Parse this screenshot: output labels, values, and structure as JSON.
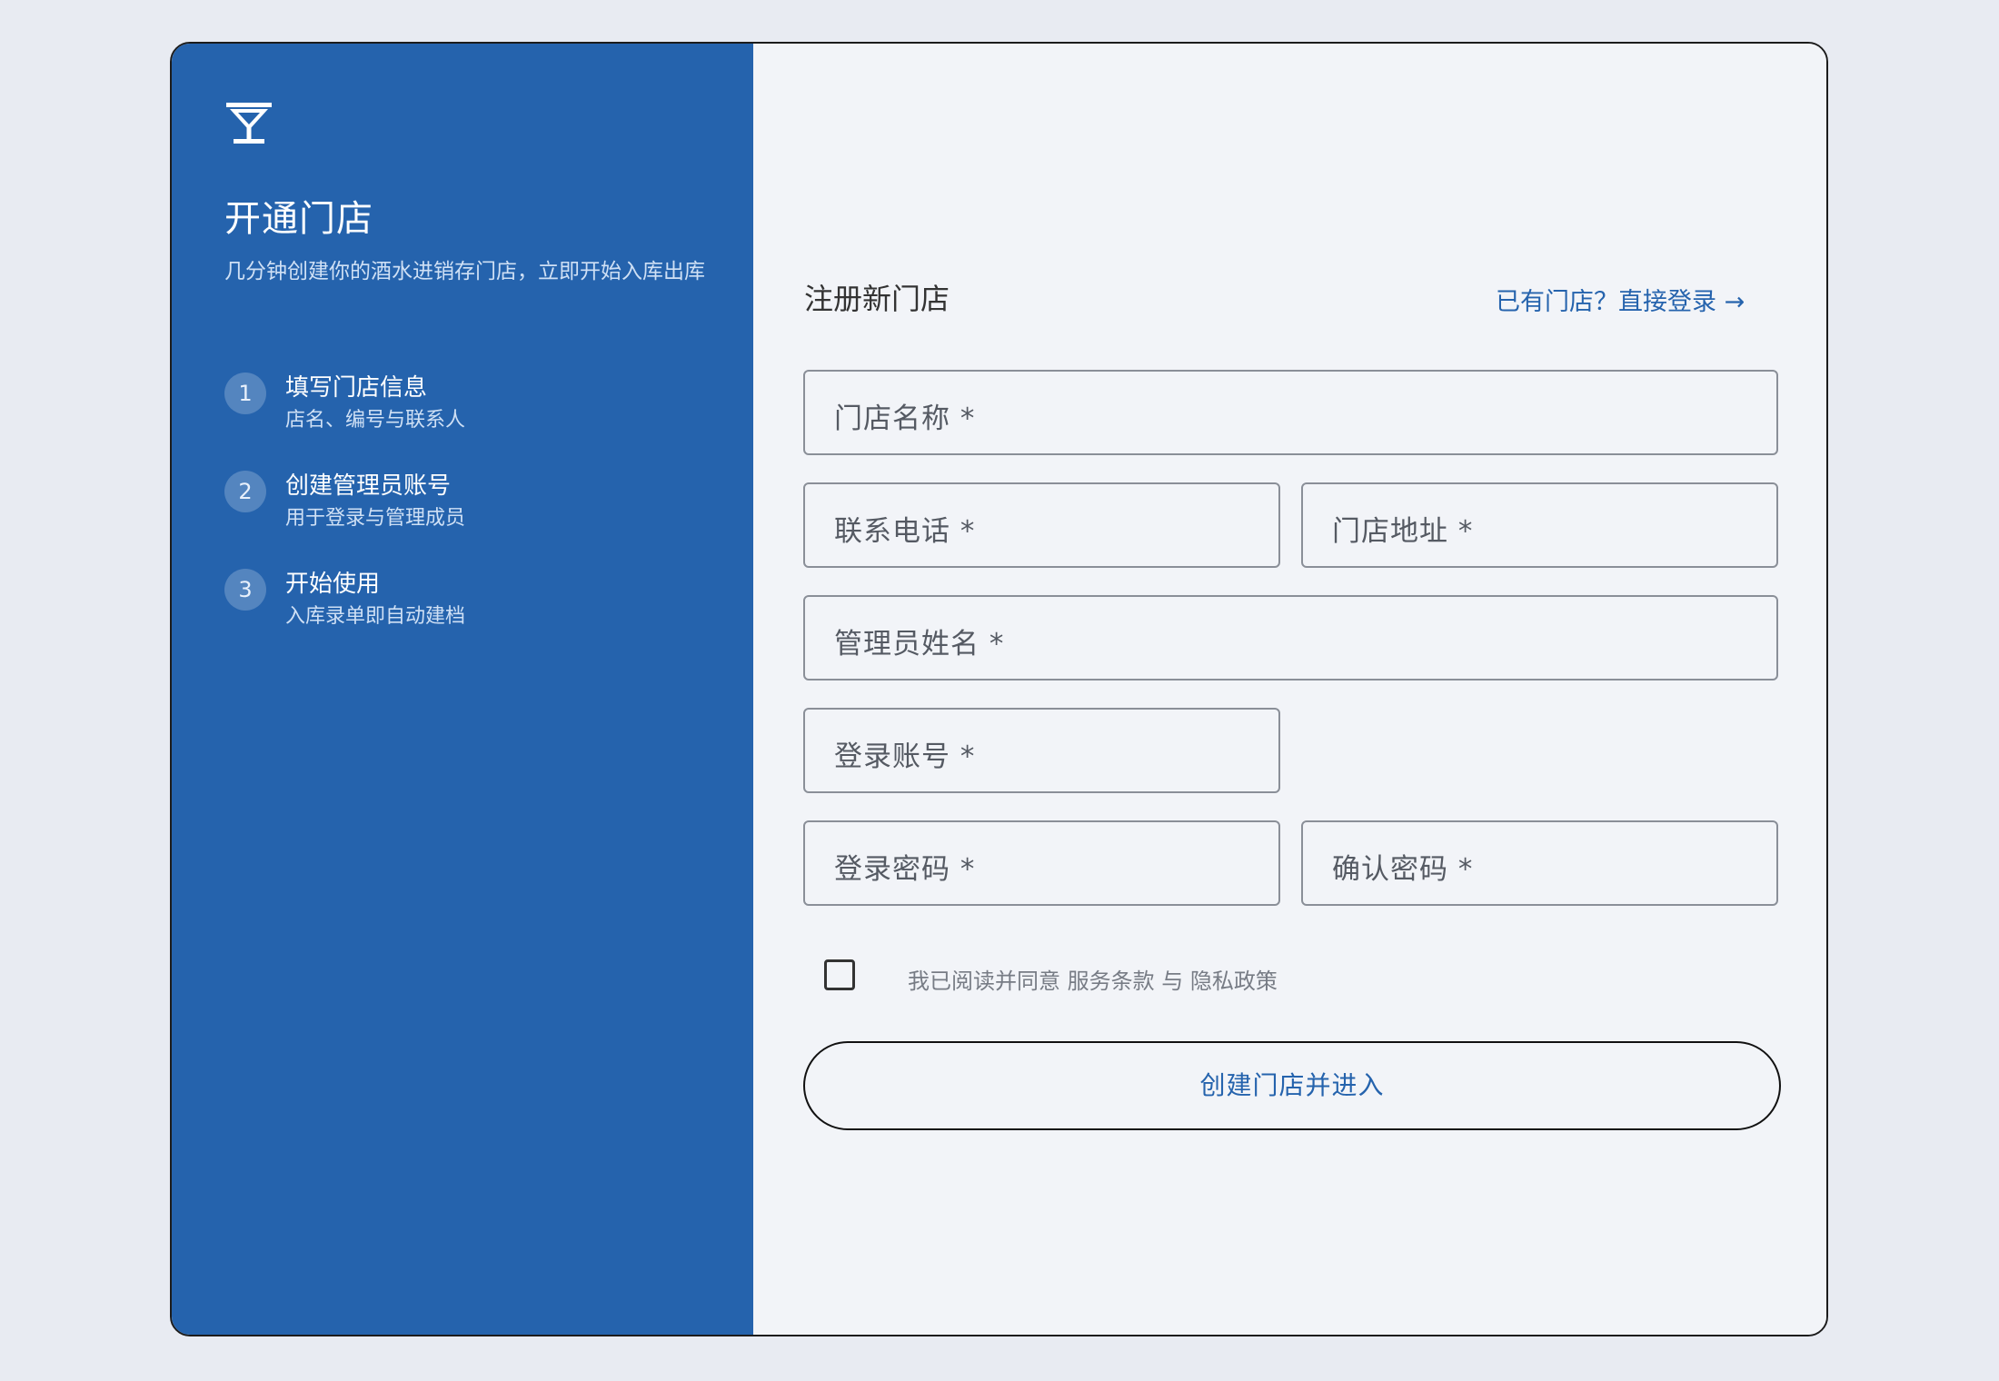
{
  "sidebar": {
    "logo_icon": "cocktail-glass-icon",
    "title": "开通门店",
    "subtitle": "几分钟创建你的酒水进销存门店，立即开始入库出库",
    "steps": [
      {
        "number": "1",
        "title": "填写门店信息",
        "desc": "店名、编号与联系人"
      },
      {
        "number": "2",
        "title": "创建管理员账号",
        "desc": "用于登录与管理成员"
      },
      {
        "number": "3",
        "title": "开始使用",
        "desc": "入库录单即自动建档"
      }
    ]
  },
  "form": {
    "title": "注册新门店",
    "login_link": "已有门店？直接登录 →",
    "fields": {
      "store_name": "门店名称 *",
      "phone": "联系电话 *",
      "address": "门店地址 *",
      "admin_name": "管理员姓名 *",
      "login_account": "登录账号 *",
      "password": "登录密码 *",
      "confirm_password": "确认密码 *"
    },
    "agree_text": "我已阅读并同意 服务条款 与 隐私政策",
    "agree_checked": false,
    "submit_label": "创建门店并进入"
  },
  "colors": {
    "sidebar_bg": "#2563ad",
    "page_bg": "#e8ebf2",
    "panel_bg": "#f2f4f8",
    "accent": "#2563ad"
  }
}
